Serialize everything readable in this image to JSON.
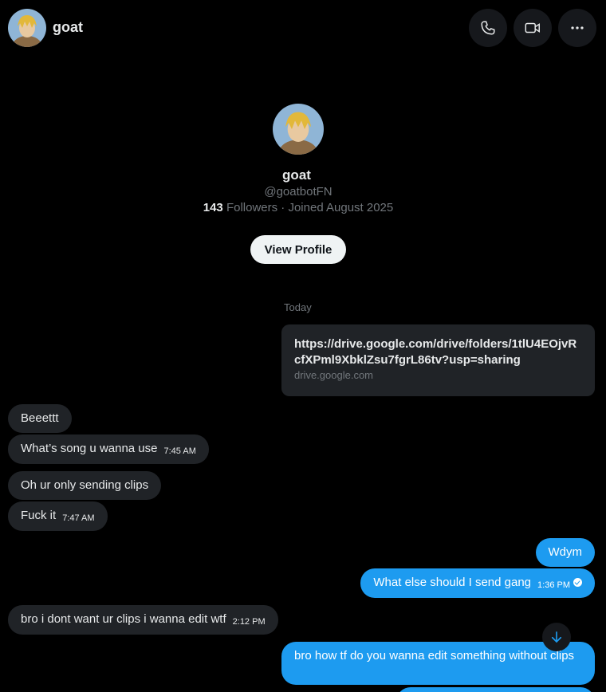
{
  "header": {
    "name": "goat",
    "avatar_icon": "user-avatar-icon",
    "call_icon": "phone-icon",
    "video_icon": "video-camera-icon",
    "more_icon": "more-horizontal-icon"
  },
  "profile": {
    "name": "goat",
    "handle": "@goatbotFN",
    "followers_count": "143",
    "followers_label": "Followers",
    "joined": "· Joined August 2025",
    "view_profile_label": "View Profile"
  },
  "conversation": {
    "day_label": "Today",
    "link_card": {
      "url": "https://drive.google.com/drive/folders/1tlU4EOjvRcfXPml9XbklZsu7fgrL86tv?usp=sharing",
      "domain": "drive.google.com"
    },
    "messages": [
      {
        "direction": "in",
        "text": "Beeettt",
        "time": ""
      },
      {
        "direction": "in",
        "text": "What’s song u wanna use",
        "time": "7:45 AM"
      },
      {
        "direction": "in",
        "text": "Oh ur only sending clips",
        "time": ""
      },
      {
        "direction": "in",
        "text": "Fuck it",
        "time": "7:47 AM"
      },
      {
        "direction": "out",
        "text": "Wdym",
        "time": ""
      },
      {
        "direction": "out",
        "text": "What else should I send gang",
        "time": "1:36 PM"
      },
      {
        "direction": "in",
        "text": "bro i dont want ur clips i wanna edit wtf",
        "time": "2:12 PM"
      },
      {
        "direction": "out",
        "text": "bro how tf do you wanna edit something without clips",
        "time": ""
      }
    ]
  },
  "colors": {
    "background": "#000000",
    "incoming_bubble": "#202327",
    "outgoing_bubble": "#1d9bf0",
    "muted_text": "#71767b"
  },
  "scroll_down_icon": "arrow-down-icon"
}
